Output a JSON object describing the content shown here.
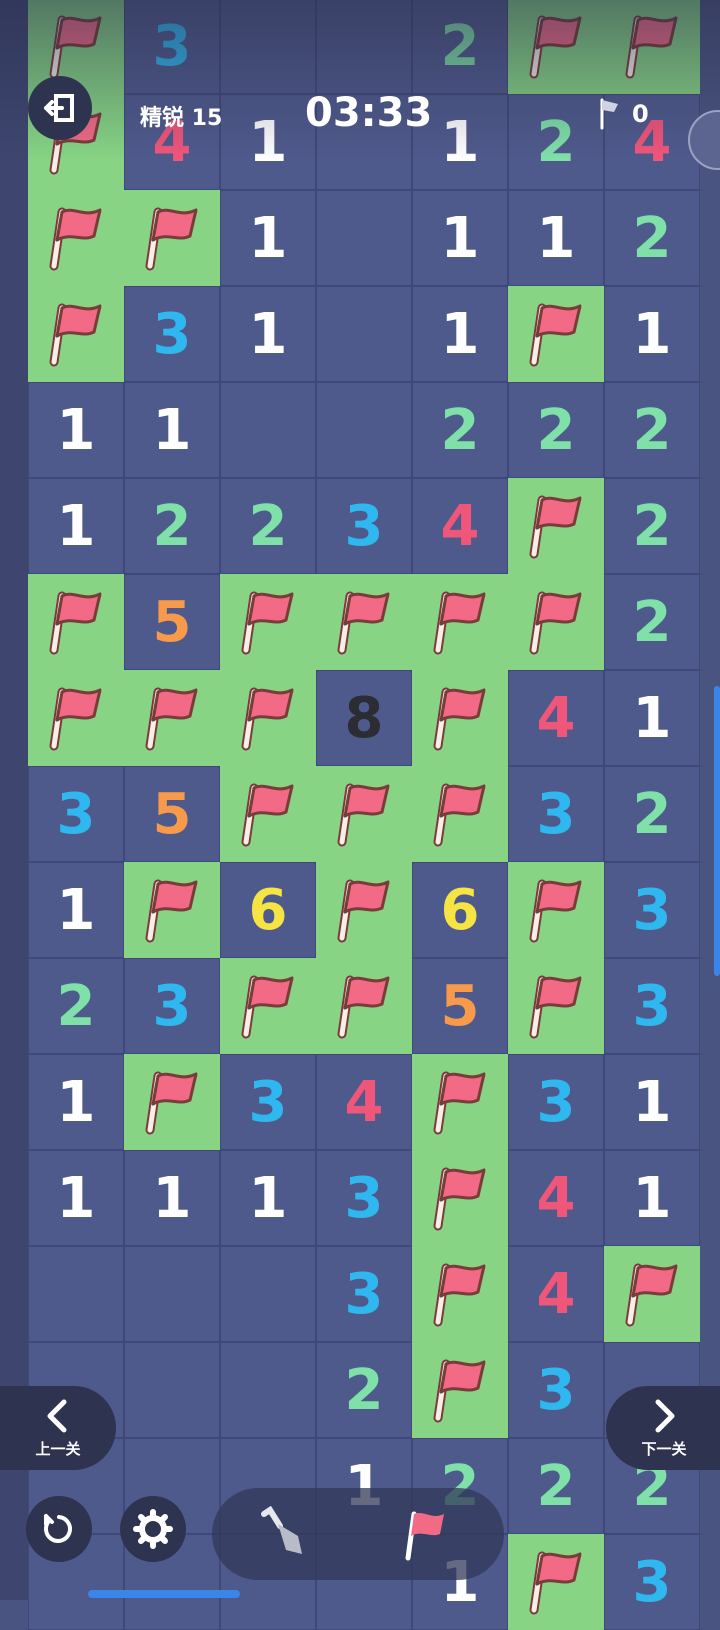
{
  "hud": {
    "level_label": "精锐 15",
    "timer": "03:33",
    "flag_count": "0",
    "exit_icon": "exit-icon",
    "flag_icon": "flag-icon"
  },
  "nav": {
    "prev_label": "上一关",
    "next_label": "下一关"
  },
  "toolbar": {
    "dig_icon": "shovel-icon",
    "flag_icon": "flag-icon",
    "restart_icon": "restart-icon",
    "settings_icon": "gear-icon"
  },
  "colors": {
    "open_cell": "#4f5a8c",
    "flag_cell": "#86d484",
    "n1": "#ffffff",
    "n2": "#7fe0a8",
    "n3": "#2fb8f0",
    "n4": "#f0557a",
    "n5": "#f79a4a",
    "n6": "#f6e445",
    "n8": "#2c2c34"
  },
  "board": [
    [
      "F",
      "3",
      "",
      "",
      "2",
      "F",
      "F"
    ],
    [
      "F",
      "4",
      "1",
      "",
      "1",
      "2",
      "4"
    ],
    [
      "F",
      "F",
      "1",
      "",
      "1",
      "1",
      "2"
    ],
    [
      "F",
      "3",
      "1",
      "",
      "1",
      "F",
      "1"
    ],
    [
      "1",
      "1",
      "",
      "",
      "2",
      "2",
      "2"
    ],
    [
      "1",
      "2",
      "2",
      "3",
      "4",
      "F",
      "2"
    ],
    [
      "F",
      "5",
      "F",
      "F",
      "F",
      "F",
      "2"
    ],
    [
      "F",
      "F",
      "F",
      "8",
      "F",
      "4",
      "1"
    ],
    [
      "3",
      "5",
      "F",
      "F",
      "F",
      "3",
      "2"
    ],
    [
      "1",
      "F",
      "6",
      "F",
      "6",
      "F",
      "3"
    ],
    [
      "2",
      "3",
      "F",
      "F",
      "5",
      "F",
      "3"
    ],
    [
      "1",
      "F",
      "3",
      "4",
      "F",
      "3",
      "1"
    ],
    [
      "1",
      "1",
      "1",
      "3",
      "F",
      "4",
      "1"
    ],
    [
      "",
      "",
      "",
      "3",
      "F",
      "4",
      "F"
    ],
    [
      "",
      "",
      "",
      "2",
      "F",
      "3",
      ""
    ],
    [
      "",
      "",
      "",
      "1",
      "2",
      "2",
      "2"
    ],
    [
      "",
      "",
      "",
      "",
      "1",
      "F",
      "3"
    ]
  ]
}
